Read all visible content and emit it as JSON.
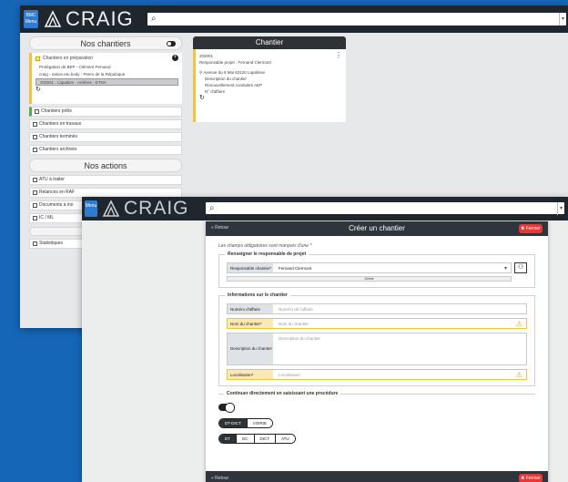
{
  "app": {
    "name": "CRAIG",
    "menu_label": "Menu",
    "menu_tag": "BMC"
  },
  "screen1": {
    "left": {
      "title": "Nos chantiers",
      "preparation": {
        "label": "Chantiers en préparation",
        "lines": [
          "Protégation de BEP - Clément Peroand",
          "craig - raison.etu.body - Peers de la Répubique",
          "202501 - Liquatien - Arrières - ETNA"
        ]
      },
      "items": [
        "Chantiers prêts",
        "Chantiers en travaux",
        "Chantiers terminés",
        "Chantiers archivés"
      ],
      "actions_title": "Nos actions",
      "actions": [
        "ATU à traiter",
        "Relances en RAF",
        "Documents à ino",
        "IC / ML",
        "Statistiques"
      ]
    },
    "chantier": {
      "title": "Chantier",
      "code": "202001",
      "responsable": "Responsable projet : Fernand Clermont",
      "address": "Avenue du 8 Mai 63120 Lapalisse",
      "lines": [
        "Description du chantier",
        "Renouvellement conduites AEP",
        "N° d'affaire"
      ]
    }
  },
  "screen2": {
    "dialog": {
      "back": "« Retour",
      "title": "Créer un chantier",
      "close": "✖ Fermer",
      "note": "Les champs obligatoires sont marqués d'une *",
      "section_resp": "Renseigner le responsable de projet",
      "resp_label": "Responsable chantier*",
      "resp_value": "Fernand Clermont",
      "delete": "Delete",
      "section_info": "Informations sur le chantier",
      "fields": [
        {
          "label": "Numéro d'affaire",
          "placeholder": "Numéro de l'affaire"
        },
        {
          "label": "Nom du chantier*",
          "placeholder": "Nom du chantier"
        },
        {
          "label": "Description du chantier",
          "placeholder": "Description du chantier"
        },
        {
          "label": "Localisation*",
          "placeholder": "Localisation"
        }
      ],
      "section_continue": "Continuer directement en saisissant une procédure",
      "seg1": [
        "DT-DICT",
        "VOIRIE"
      ],
      "seg2": [
        "DT",
        "DC",
        "DICT",
        "ATU"
      ],
      "foot_back": "« Retour",
      "foot_close": "✖ Fermer"
    }
  },
  "colors": {
    "background": "#1666b8",
    "accent": "#f0c340",
    "danger": "#e53935",
    "dark": "#2d3237"
  }
}
